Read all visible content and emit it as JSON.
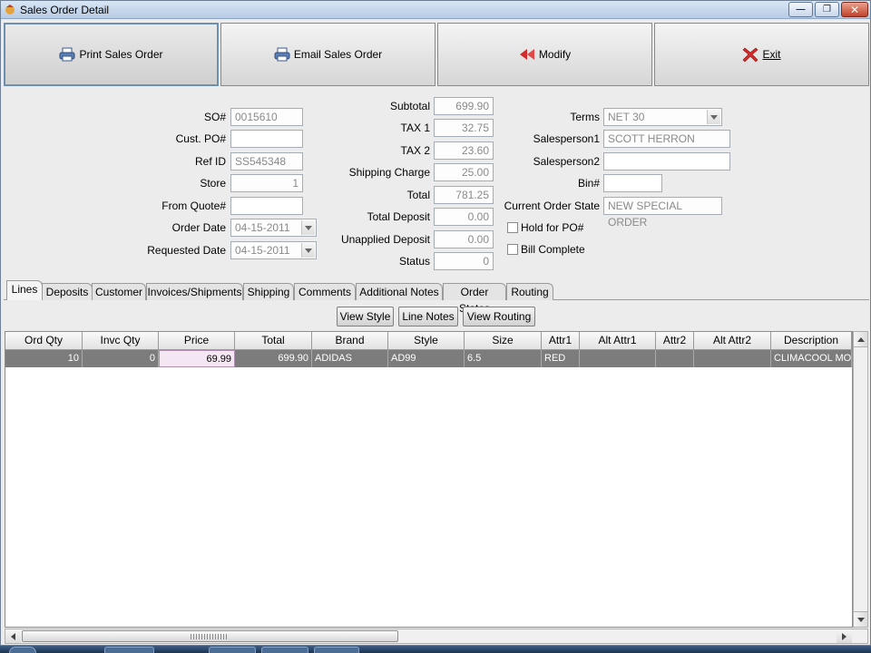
{
  "window": {
    "title": "Sales Order Detail"
  },
  "toolbar": {
    "print": "Print Sales Order",
    "email": "Email Sales Order",
    "modify": "Modify",
    "exit": "Exit"
  },
  "form": {
    "so_label": "SO#",
    "so_value": "0015610",
    "cust_po_label": "Cust. PO#",
    "cust_po_value": "",
    "ref_id_label": "Ref ID",
    "ref_id_value": "SS545348",
    "store_label": "Store",
    "store_value": "1",
    "from_quote_label": "From Quote#",
    "from_quote_value": "",
    "order_date_label": "Order Date",
    "order_date_value": "04-15-2011",
    "requested_date_label": "Requested Date",
    "requested_date_value": "04-15-2011",
    "subtotal_label": "Subtotal",
    "subtotal_value": "699.90",
    "tax1_label": "TAX 1",
    "tax1_value": "32.75",
    "tax2_label": "TAX 2",
    "tax2_value": "23.60",
    "shipping_label": "Shipping Charge",
    "shipping_value": "25.00",
    "total_label": "Total",
    "total_value": "781.25",
    "total_deposit_label": "Total Deposit",
    "total_deposit_value": "0.00",
    "unapplied_label": "Unapplied Deposit",
    "unapplied_value": "0.00",
    "status_label": "Status",
    "status_value": "0",
    "terms_label": "Terms",
    "terms_value": "NET 30",
    "sp1_label": "Salesperson1",
    "sp1_value": "SCOTT HERRON",
    "sp2_label": "Salesperson2",
    "sp2_value": "",
    "bin_label": "Bin#",
    "bin_value": "",
    "state_label": "Current Order State",
    "state_value": "NEW SPECIAL ORDER",
    "hold_label": "Hold for PO#",
    "bill_label": "Bill Complete"
  },
  "tabs": [
    "Lines",
    "Deposits",
    "Customer",
    "Invoices/Shipments",
    "Shipping",
    "Comments",
    "Additional Notes",
    "Order States",
    "Routing"
  ],
  "subbuttons": {
    "view_style": "View Style",
    "line_notes": "Line Notes",
    "view_routing": "View Routing"
  },
  "grid": {
    "columns": [
      "Ord Qty",
      "Invc Qty",
      "Price",
      "Total",
      "Brand",
      "Style",
      "Size",
      "Attr1",
      "Alt Attr1",
      "Attr2",
      "Alt Attr2",
      "Description"
    ],
    "rows": [
      [
        "10",
        "0",
        "69.99",
        "699.90",
        "ADIDAS",
        "AD99",
        "6.5",
        "RED",
        "",
        "",
        "",
        "CLIMACOOL MOSS"
      ]
    ]
  },
  "colors": {
    "accent": "#6d8fb3",
    "row_bg": "#7c7c7c",
    "selected_cell": "#f5e6f3"
  }
}
